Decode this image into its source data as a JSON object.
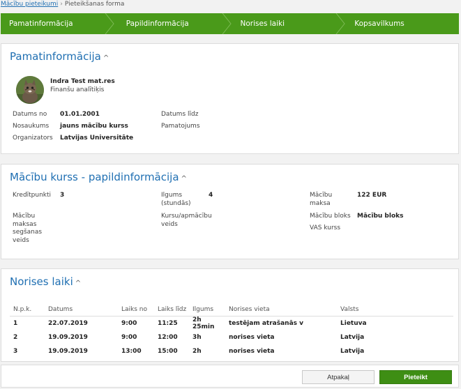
{
  "breadcrumb": {
    "link": "Mācību pieteikumi",
    "sep": "›",
    "current": "Pieteikšanas forma"
  },
  "steps": [
    "Pamatinformācija",
    "Papildinformācija",
    "Norises laiki",
    "Kopsavilkums"
  ],
  "basic": {
    "title": "Pamatinformācija",
    "person_name": "Indra Test mat.res",
    "person_role": "Finanšu analītiķis",
    "date_from_label": "Datums no",
    "date_from": "01.01.2001",
    "date_to_label": "Datums līdz",
    "name_label": "Nosaukums",
    "name": "jauns mācību kurss",
    "reason_label": "Pamatojums",
    "organizer_label": "Organizators",
    "organizer": "Latvijas Universitāte"
  },
  "course": {
    "title": "Mācību kurss - papildinformācija",
    "credits_label": "Kredītpunkti",
    "credits": "3",
    "duration_label": "Ilgums (stundās)",
    "duration": "4",
    "price_label": "Mācību maksa",
    "price": "122 EUR",
    "payment_label": "Mācību maksas segšanas veids",
    "type_label": "Kursu/apmācību veids",
    "block_label": "Mācību bloks",
    "block": "Mācību bloks",
    "vas_label": "VAS kurss"
  },
  "schedule": {
    "title": "Norises laiki",
    "headers": [
      "N.p.k.",
      "Datums",
      "Laiks no",
      "Laiks līdz",
      "Ilgums",
      "Norises vieta",
      "Valsts"
    ],
    "rows": [
      [
        "1",
        "22.07.2019",
        "9:00",
        "11:25",
        "2h 25min",
        "testējam atrašanās v",
        "Lietuva"
      ],
      [
        "2",
        "19.09.2019",
        "9:00",
        "12:00",
        "3h",
        "norises vieta",
        "Latvija"
      ],
      [
        "3",
        "19.09.2019",
        "13:00",
        "15:00",
        "2h",
        "norises vieta",
        "Latvija"
      ]
    ]
  },
  "footer": {
    "back": "Atpakaļ",
    "submit": "Pieteikt"
  },
  "colors": {
    "accent": "#4a9a1a",
    "link": "#1f6fb2"
  }
}
